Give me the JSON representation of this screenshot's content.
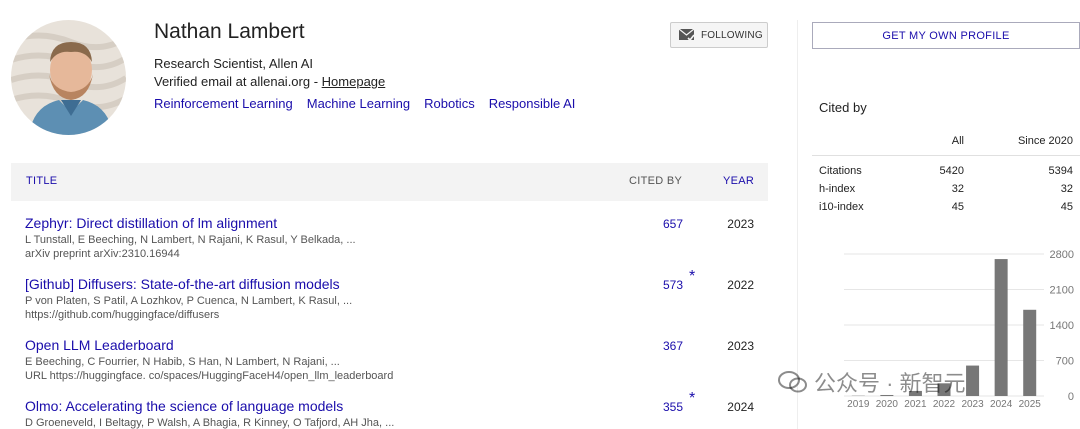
{
  "profile": {
    "name": "Nathan Lambert",
    "affiliation": "Research Scientist, Allen AI",
    "email_text": "Verified email at allenai.org - ",
    "homepage_label": "Homepage",
    "interests": [
      "Reinforcement Learning",
      "Machine Learning",
      "Robotics",
      "Responsible AI"
    ],
    "follow_label": "FOLLOWING"
  },
  "table": {
    "col_title": "TITLE",
    "col_cited": "CITED BY",
    "col_year": "YEAR",
    "rows": [
      {
        "title": "Zephyr: Direct distillation of lm alignment",
        "authors": "L Tunstall, E Beeching, N Lambert, N Rajani, K Rasul, Y Belkada, ...",
        "venue": "arXiv preprint arXiv:2310.16944",
        "cited": "657",
        "star": "",
        "year": "2023"
      },
      {
        "title": "[Github] Diffusers: State-of-the-art diffusion models",
        "authors": "P von Platen, S Patil, A Lozhkov, P Cuenca, N Lambert, K Rasul, ...",
        "venue": "https://github.com/huggingface/diffusers",
        "cited": "573",
        "star": "*",
        "year": "2022"
      },
      {
        "title": "Open LLM Leaderboard",
        "authors": "E Beeching, C Fourrier, N Habib, S Han, N Lambert, N Rajani, ...",
        "venue": "URL https://huggingface. co/spaces/HuggingFaceH4/open_llm_leaderboard",
        "cited": "367",
        "star": "",
        "year": "2023"
      },
      {
        "title": "Olmo: Accelerating the science of language models",
        "authors": "D Groeneveld, I Beltagy, P Walsh, A Bhagia, R Kinney, O Tafjord, AH Jha, ...",
        "venue": "",
        "cited": "355",
        "star": "*",
        "year": "2024"
      }
    ]
  },
  "sidebar": {
    "own_profile_label": "GET MY OWN PROFILE",
    "cited_by_label": "Cited by",
    "col_all": "All",
    "col_since": "Since 2020",
    "stats": [
      {
        "label": "Citations",
        "all": "5420",
        "since": "5394"
      },
      {
        "label": "h-index",
        "all": "32",
        "since": "32"
      },
      {
        "label": "i10-index",
        "all": "45",
        "since": "45"
      }
    ]
  },
  "chart_data": {
    "type": "bar",
    "categories": [
      "2019",
      "2020",
      "2021",
      "2022",
      "2023",
      "2024",
      "2025"
    ],
    "values": [
      5,
      20,
      100,
      250,
      600,
      2700,
      1700
    ],
    "yticks": [
      "2800",
      "2100",
      "1400",
      "700",
      "0"
    ],
    "ylim": [
      0,
      2800
    ],
    "bar_color": "#777777"
  },
  "watermark": {
    "text": "公众号 · 新智元"
  }
}
